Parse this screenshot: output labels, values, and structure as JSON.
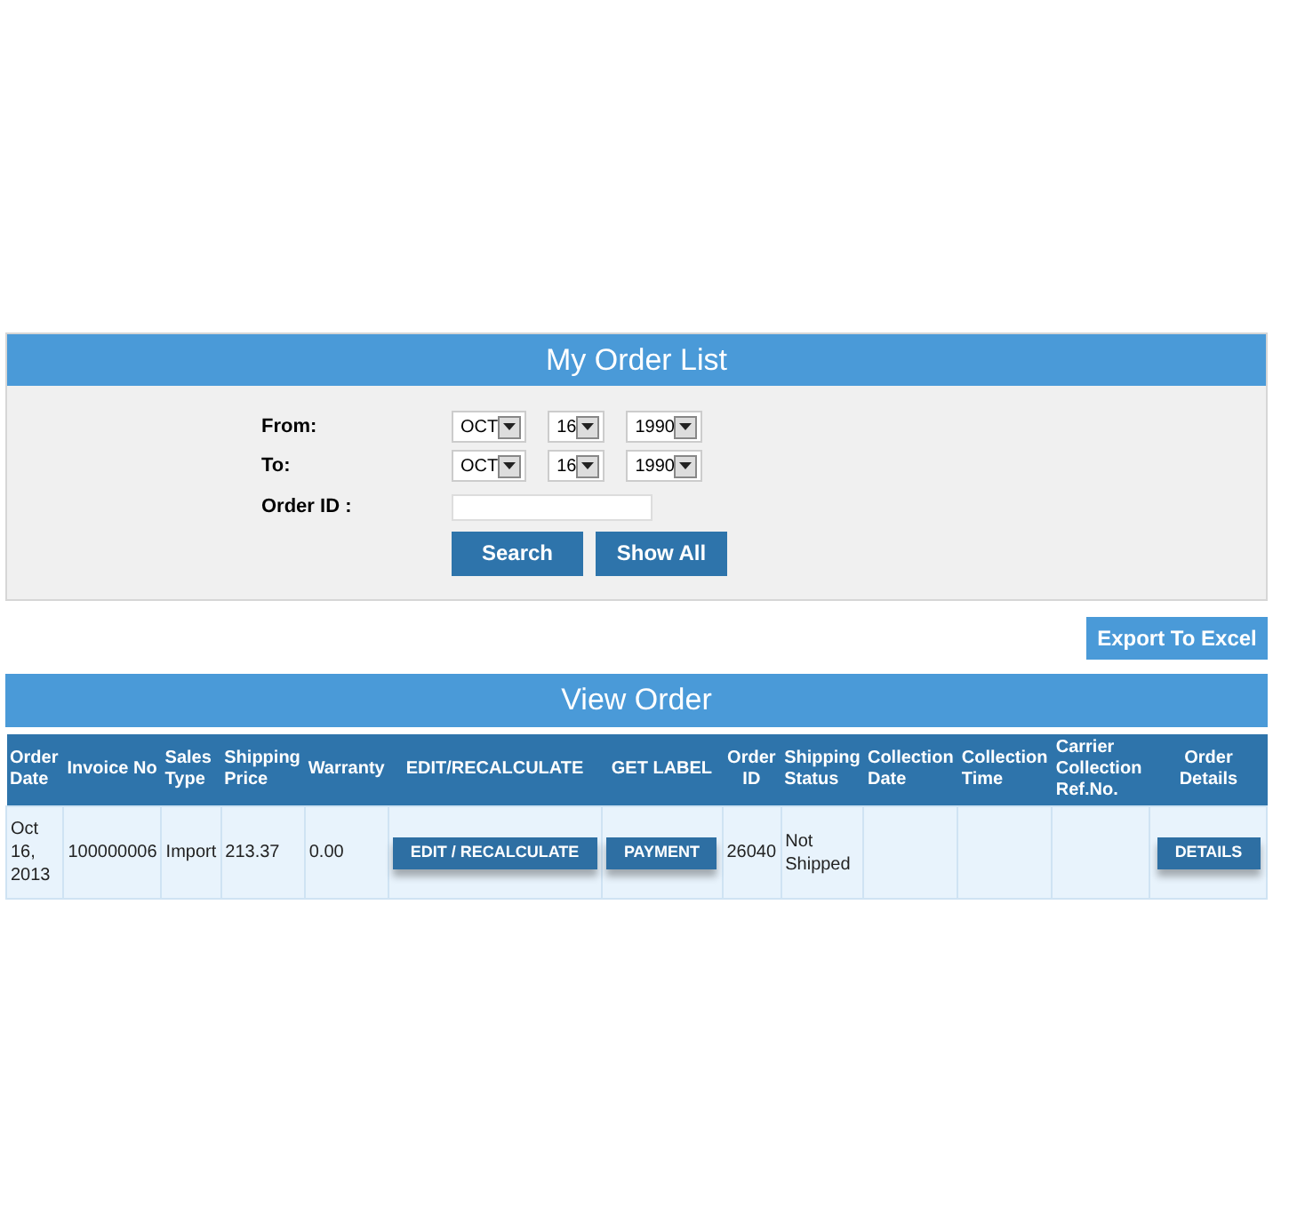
{
  "search_panel": {
    "title": "My Order List",
    "from": {
      "label": "From:",
      "month": "OCT",
      "day": "16",
      "year": "1990"
    },
    "to": {
      "label": "To:",
      "month": "OCT",
      "day": "16",
      "year": "1990"
    },
    "order_id": {
      "label": "Order ID :"
    },
    "buttons": [
      "Search",
      "Show All"
    ]
  },
  "export_button": "Export To Excel",
  "table": {
    "title": "View Order",
    "columns": [
      "Order Date",
      "Invoice No",
      "Sales Type",
      "Shipping Price",
      "Warranty",
      "EDIT/RECALCULATE",
      "GET LABEL",
      "Order ID",
      "Shipping Status",
      "Collection Date",
      "Collection Time",
      "Carrier Collection Ref.No.",
      "Order Details"
    ],
    "rows": [
      [
        {
          "kind": "text",
          "text": "Oct 16, 2013"
        },
        {
          "kind": "text",
          "text": "100000006"
        },
        {
          "kind": "text",
          "text": "Import"
        },
        {
          "kind": "text",
          "text": "213.37"
        },
        {
          "kind": "text",
          "text": "0.00"
        },
        {
          "kind": "button",
          "text": "EDIT / RECALCULATE"
        },
        {
          "kind": "button",
          "text": "PAYMENT"
        },
        {
          "kind": "text",
          "text": "26040"
        },
        {
          "kind": "text",
          "text": "Not Shipped"
        },
        {
          "kind": "empty"
        },
        {
          "kind": "empty"
        },
        {
          "kind": "empty"
        },
        {
          "kind": "button",
          "text": "DETAILS"
        }
      ]
    ]
  }
}
